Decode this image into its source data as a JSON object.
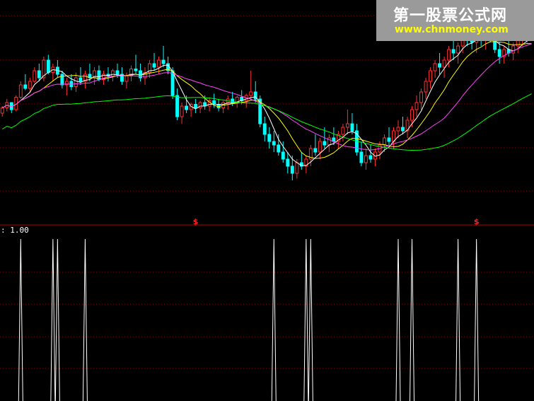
{
  "chart_data": [
    {
      "type": "candlestick",
      "title": "",
      "xlabel": "",
      "ylabel": "",
      "ylim": [
        0,
        100
      ],
      "grid": true,
      "colors": {
        "up": "#ff3030",
        "down": "#00ffff",
        "ma5": "#ffffff",
        "ma10": "#ffff00",
        "ma20": "#ff44ff",
        "ma60": "#00ff00",
        "grid": "#8b0000",
        "signal": "#ff2020"
      },
      "candles": [
        [
          52,
          56,
          50,
          55
        ],
        [
          55,
          60,
          53,
          58
        ],
        [
          58,
          57,
          52,
          54
        ],
        [
          54,
          62,
          53,
          61
        ],
        [
          61,
          70,
          60,
          68
        ],
        [
          68,
          74,
          65,
          66
        ],
        [
          66,
          72,
          64,
          70
        ],
        [
          70,
          78,
          69,
          76
        ],
        [
          76,
          80,
          70,
          72
        ],
        [
          72,
          84,
          70,
          82
        ],
        [
          82,
          85,
          74,
          75
        ],
        [
          75,
          80,
          70,
          78
        ],
        [
          78,
          82,
          72,
          74
        ],
        [
          74,
          76,
          66,
          68
        ],
        [
          68,
          72,
          62,
          70
        ],
        [
          70,
          74,
          65,
          67
        ],
        [
          67,
          75,
          64,
          72
        ],
        [
          72,
          78,
          68,
          70
        ],
        [
          70,
          76,
          66,
          74
        ],
        [
          74,
          80,
          70,
          72
        ],
        [
          72,
          78,
          68,
          76
        ],
        [
          76,
          79,
          70,
          71
        ],
        [
          71,
          76,
          68,
          74
        ],
        [
          74,
          78,
          70,
          73
        ],
        [
          73,
          77,
          70,
          76
        ],
        [
          76,
          80,
          72,
          74
        ],
        [
          74,
          78,
          68,
          70
        ],
        [
          70,
          75,
          66,
          73
        ],
        [
          73,
          79,
          70,
          77
        ],
        [
          77,
          85,
          74,
          76
        ],
        [
          76,
          80,
          70,
          72
        ],
        [
          72,
          78,
          68,
          75
        ],
        [
          75,
          82,
          72,
          80
        ],
        [
          80,
          86,
          76,
          78
        ],
        [
          78,
          84,
          74,
          82
        ],
        [
          82,
          90,
          78,
          80
        ],
        [
          80,
          84,
          74,
          76
        ],
        [
          76,
          78,
          60,
          62
        ],
        [
          62,
          66,
          48,
          50
        ],
        [
          50,
          58,
          46,
          56
        ],
        [
          56,
          62,
          52,
          54
        ],
        [
          54,
          58,
          50,
          57
        ],
        [
          57,
          60,
          52,
          55
        ],
        [
          55,
          59,
          52,
          58
        ],
        [
          58,
          62,
          54,
          56
        ],
        [
          56,
          61,
          53,
          59
        ],
        [
          59,
          63,
          55,
          57
        ],
        [
          57,
          60,
          53,
          55
        ],
        [
          55,
          59,
          52,
          58
        ],
        [
          58,
          62,
          54,
          60
        ],
        [
          60,
          64,
          56,
          58
        ],
        [
          58,
          62,
          55,
          61
        ],
        [
          61,
          65,
          57,
          59
        ],
        [
          59,
          63,
          55,
          62
        ],
        [
          62,
          76,
          60,
          64
        ],
        [
          64,
          70,
          58,
          60
        ],
        [
          60,
          62,
          44,
          46
        ],
        [
          46,
          50,
          36,
          40
        ],
        [
          40,
          44,
          32,
          36
        ],
        [
          36,
          42,
          30,
          34
        ],
        [
          34,
          40,
          28,
          30
        ],
        [
          30,
          36,
          24,
          26
        ],
        [
          26,
          30,
          18,
          22
        ],
        [
          22,
          28,
          14,
          18
        ],
        [
          18,
          26,
          15,
          24
        ],
        [
          24,
          30,
          20,
          22
        ],
        [
          22,
          28,
          18,
          26
        ],
        [
          26,
          34,
          22,
          32
        ],
        [
          32,
          40,
          28,
          30
        ],
        [
          30,
          38,
          26,
          36
        ],
        [
          36,
          44,
          32,
          34
        ],
        [
          34,
          40,
          30,
          38
        ],
        [
          38,
          44,
          34,
          36
        ],
        [
          36,
          42,
          32,
          40
        ],
        [
          40,
          46,
          36,
          44
        ],
        [
          44,
          54,
          40,
          46
        ],
        [
          46,
          52,
          40,
          42
        ],
        [
          42,
          46,
          28,
          30
        ],
        [
          30,
          36,
          22,
          24
        ],
        [
          24,
          32,
          20,
          28
        ],
        [
          28,
          34,
          24,
          26
        ],
        [
          26,
          32,
          22,
          30
        ],
        [
          30,
          36,
          26,
          34
        ],
        [
          34,
          40,
          30,
          38
        ],
        [
          38,
          44,
          34,
          36
        ],
        [
          36,
          44,
          32,
          42
        ],
        [
          42,
          48,
          38,
          44
        ],
        [
          44,
          50,
          40,
          42
        ],
        [
          42,
          50,
          38,
          48
        ],
        [
          48,
          56,
          44,
          54
        ],
        [
          54,
          62,
          50,
          58
        ],
        [
          58,
          66,
          54,
          64
        ],
        [
          64,
          72,
          60,
          70
        ],
        [
          70,
          78,
          66,
          76
        ],
        [
          76,
          82,
          72,
          80
        ],
        [
          80,
          86,
          74,
          78
        ],
        [
          78,
          84,
          72,
          82
        ],
        [
          82,
          90,
          78,
          88
        ],
        [
          88,
          94,
          82,
          86
        ],
        [
          86,
          92,
          80,
          90
        ],
        [
          90,
          98,
          86,
          96
        ],
        [
          96,
          99,
          90,
          94
        ],
        [
          94,
          98,
          88,
          92
        ],
        [
          92,
          97,
          86,
          95
        ],
        [
          95,
          99,
          90,
          93
        ],
        [
          93,
          98,
          88,
          96
        ],
        [
          96,
          99,
          92,
          94
        ],
        [
          94,
          97,
          86,
          88
        ],
        [
          88,
          92,
          80,
          84
        ],
        [
          84,
          90,
          80,
          88
        ],
        [
          88,
          94,
          84,
          86
        ],
        [
          86,
          92,
          82,
          90
        ],
        [
          90,
          96,
          86,
          94
        ],
        [
          94,
          99,
          90,
          96
        ],
        [
          96,
          99,
          92,
          98
        ],
        [
          98,
          99,
          94,
          95
        ]
      ],
      "signals": [
        42,
        103
      ],
      "signal_label": "$"
    },
    {
      "type": "bar",
      "title": "",
      "label": ": 1.00",
      "ylim": [
        0,
        1
      ],
      "x": [
        4,
        11,
        12,
        18,
        59,
        66,
        67,
        86,
        89,
        99,
        103
      ],
      "values": [
        1,
        1,
        1,
        1,
        1,
        1,
        1,
        1,
        1,
        1,
        1
      ]
    }
  ],
  "watermark": {
    "cn": "第一股票公式网",
    "url": "www.chnmoney.com"
  }
}
